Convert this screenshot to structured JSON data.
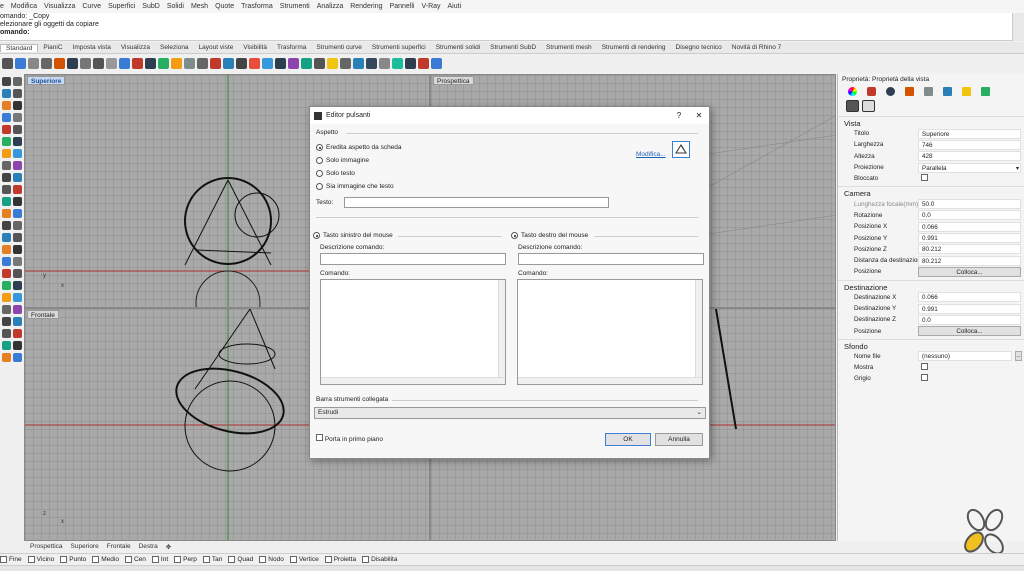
{
  "menubar": [
    "e",
    "Modifica",
    "Visualizza",
    "Curve",
    "Superfici",
    "SubD",
    "Solidi",
    "Mesh",
    "Quote",
    "Trasforma",
    "Strumenti",
    "Analizza",
    "Rendering",
    "Pannelli",
    "V-Ray",
    "Aiuti"
  ],
  "command_history": [
    "omando: _Copy",
    "elezionare gli oggetti da copiare",
    "omando:"
  ],
  "toolbar_tabs": [
    "Standard",
    "PianiC",
    "Imposta vista",
    "Visualizza",
    "Seleziona",
    "Layout viste",
    "Visibilità",
    "Trasforma",
    "Strumenti curve",
    "Strumenti superfici",
    "Strumenti solidi",
    "Strumenti SubD",
    "Strumenti mesh",
    "Strumenti di rendering",
    "Disegno tecnico",
    "Novità di Rhino 7"
  ],
  "viewports": {
    "top": "Superiore",
    "perspective": "Prospettica",
    "front": "Frontale"
  },
  "viewport_tabs": [
    "Prospettica",
    "Superiore",
    "Frontale",
    "Destra",
    "✥"
  ],
  "osnap": [
    "Fine",
    "Vicino",
    "Punto",
    "Medio",
    "Cen",
    "Int",
    "Perp",
    "Tan",
    "Quad",
    "Nodo",
    "Vertice",
    "Proietta",
    "Disabilita"
  ],
  "properties": {
    "title": "Proprietà: Proprietà della vista",
    "sections": {
      "vista": "Vista",
      "camera": "Camera",
      "destinazione": "Destinazione",
      "sfondo": "Sfondo"
    },
    "vista": [
      {
        "k": "Titolo",
        "v": "Superiore"
      },
      {
        "k": "Larghezza",
        "v": "746"
      },
      {
        "k": "Altezza",
        "v": "428"
      },
      {
        "k": "Proiezione",
        "v": "Parallela"
      },
      {
        "k": "Bloccato",
        "v": ""
      }
    ],
    "camera": [
      {
        "k": "Lunghezza focale(mm)",
        "v": "50.0"
      },
      {
        "k": "Rotazione",
        "v": "0.0"
      },
      {
        "k": "Posizione X",
        "v": "0.066"
      },
      {
        "k": "Posizione Y",
        "v": "0.991"
      },
      {
        "k": "Posizione Z",
        "v": "80.212"
      },
      {
        "k": "Distanza da destinazione",
        "v": "80.212"
      },
      {
        "k": "Posizione",
        "v": "Colloca..."
      }
    ],
    "destinazione": [
      {
        "k": "Destinazione X",
        "v": "0.066"
      },
      {
        "k": "Destinazione Y",
        "v": "0.991"
      },
      {
        "k": "Destinazione Z",
        "v": "0.0"
      },
      {
        "k": "Posizione",
        "v": "Colloca..."
      }
    ],
    "sfondo": [
      {
        "k": "Nome file",
        "v": "(nessuno)"
      },
      {
        "k": "Mostra",
        "v": ""
      },
      {
        "k": "Grigio",
        "v": ""
      }
    ]
  },
  "dialog": {
    "title": "Editor pulsanti",
    "help": "?",
    "close": "✕",
    "aspect_group": "Aspetto",
    "radios": [
      "Eredita aspetto da scheda",
      "Solo immagine",
      "Solo testo",
      "Sia immagine che testo"
    ],
    "modify_link": "Modifica...",
    "text_label": "Testo:",
    "left_mouse": "Tasto sinistro del mouse",
    "right_mouse": "Tasto destro del mouse",
    "cmd_desc": "Descrizione comando:",
    "cmd": "Comando:",
    "linked_toolbar": "Barra strumenti collegata",
    "linked_value": "Estrudi",
    "foreground": "Porta in primo piano",
    "ok": "OK",
    "cancel": "Annulla"
  },
  "colors": {
    "viewport_bg": "#a9a9a9",
    "active_label": "#c6d9f0",
    "link": "#1a5fb4",
    "x_axis": "#b03030",
    "y_axis": "#2e8b2e"
  }
}
